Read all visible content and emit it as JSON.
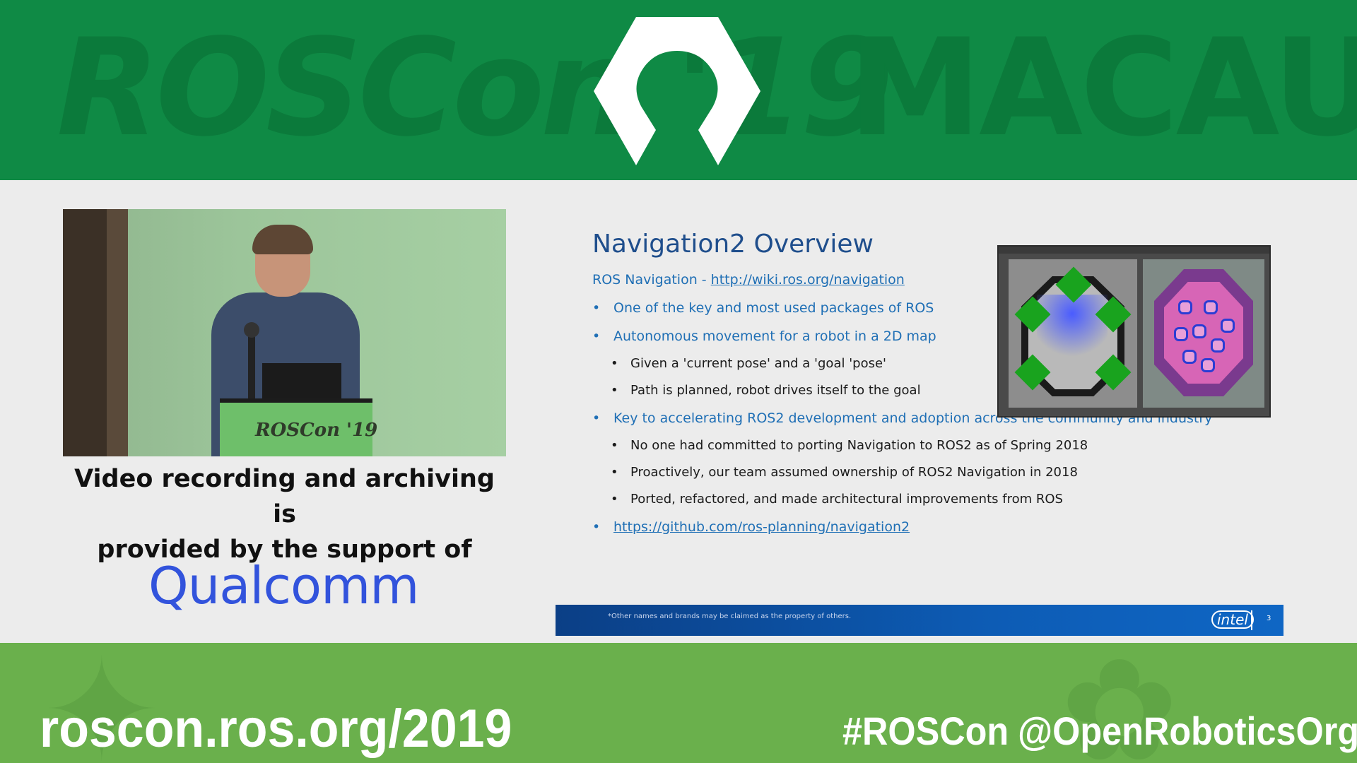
{
  "banner": {
    "bg_text_left": "ROSCon '19",
    "bg_text_right": "MACAU",
    "logo_icon": "ros-logo-icon"
  },
  "sponsor": {
    "line1": "Video recording and archiving is",
    "line2": "provided by the support of",
    "logo_text": "Qualcomm",
    "podium_text": "ROSCon '19"
  },
  "slide": {
    "title": "Navigation2 Overview",
    "intro_label": "ROS Navigation - ",
    "intro_link": "http://wiki.ros.org/navigation",
    "bullet1": "One of the key and most used packages of ROS",
    "bullet2": "Autonomous movement for a robot in a 2D map",
    "sub2a": "Given a 'current pose' and a 'goal 'pose'",
    "sub2b": "Path is planned, robot drives itself to the goal",
    "bullet3": "Key to accelerating ROS2 development and adoption across the community and industry",
    "sub3a": "No one had committed to porting Navigation to ROS2 as of Spring 2018",
    "sub3b": "Proactively, our team assumed ownership of ROS2 Navigation in 2018",
    "sub3c": "Ported, refactored, and made architectural improvements from ROS",
    "bullet4_link": "https://github.com/ros-planning/navigation2",
    "footer_disclaimer": "*Other names and brands may be claimed as the property of others.",
    "intel_logo": "intel",
    "page_number": "3"
  },
  "footer": {
    "url": "roscon.ros.org/2019",
    "hashtag": "#ROSCon",
    "handle": "@OpenRoboticsOrg"
  },
  "colors": {
    "top_banner": "#0f8a45",
    "bottom_banner": "#6ab04c",
    "slide_blue": "#1f4e8c",
    "qualcomm_blue": "#3253dc"
  }
}
